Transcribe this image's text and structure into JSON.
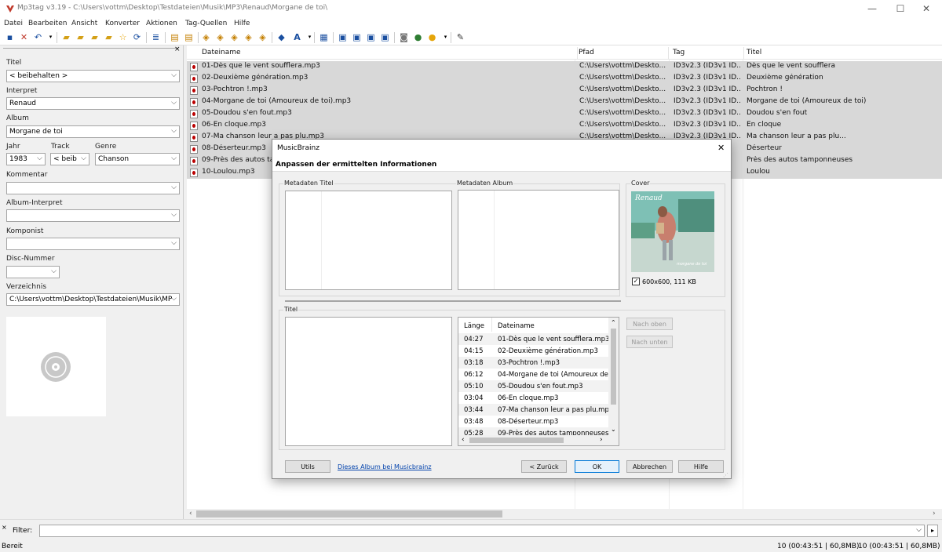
{
  "window": {
    "title": "Mp3tag v3.19  -  C:\\Users\\vottm\\Desktop\\Testdateien\\Musik\\MP3\\Renaud\\Morgane de toi\\",
    "minimize": "—",
    "maximize": "☐",
    "close": "✕"
  },
  "menu": [
    "Datei",
    "Bearbeiten",
    "Ansicht",
    "Konverter",
    "Aktionen",
    "Tag-Quellen",
    "Hilfe"
  ],
  "toolbar_icons": [
    "save-icon",
    "delete-icon",
    "undo-icon",
    "open-folder-icon",
    "add-folder-icon",
    "folder-icon",
    "folder-star-icon",
    "favorite-icon",
    "refresh-icon",
    "playlist-icon",
    "tag-filename-icon",
    "filename-tag-icon",
    "tag-tag-icon",
    "text-filename-icon",
    "export-icon",
    "actions-icon",
    "case-icon",
    "autonumber-icon",
    "tag-edit-icon",
    "freedb-icon",
    "musicbrainz-icon",
    "discogs-icon",
    "amazon-icon",
    "cd-icon",
    "web-icon",
    "settings-icon"
  ],
  "panel": {
    "close": "×",
    "title_label": "Titel",
    "title_value": "< beibehalten >",
    "artist_label": "Interpret",
    "artist_value": "Renaud",
    "album_label": "Album",
    "album_value": "Morgane de toi",
    "year_label": "Jahr",
    "year_value": "1983",
    "track_label": "Track",
    "track_value": "< beib",
    "genre_label": "Genre",
    "genre_value": "Chanson",
    "comment_label": "Kommentar",
    "comment_value": "",
    "albumartist_label": "Album-Interpret",
    "albumartist_value": "",
    "composer_label": "Komponist",
    "composer_value": "",
    "disc_label": "Disc-Nummer",
    "disc_value": "",
    "dir_label": "Verzeichnis",
    "dir_value": "C:\\Users\\vottm\\Desktop\\Testdateien\\Musik\\MP"
  },
  "columns": [
    "Dateiname",
    "Pfad",
    "Tag",
    "Titel"
  ],
  "files": [
    {
      "name": "01-Dès que le vent soufflera.mp3",
      "path": "C:\\Users\\vottm\\Deskto...",
      "tag": "ID3v2.3 (ID3v1 ID...",
      "title": "Dès que le vent soufflera"
    },
    {
      "name": "02-Deuxième génération.mp3",
      "path": "C:\\Users\\vottm\\Deskto...",
      "tag": "ID3v2.3 (ID3v1 ID...",
      "title": "Deuxième génération"
    },
    {
      "name": "03-Pochtron !.mp3",
      "path": "C:\\Users\\vottm\\Deskto...",
      "tag": "ID3v2.3 (ID3v1 ID...",
      "title": "Pochtron !"
    },
    {
      "name": "04-Morgane de toi (Amoureux de toi).mp3",
      "path": "C:\\Users\\vottm\\Deskto...",
      "tag": "ID3v2.3 (ID3v1 ID...",
      "title": "Morgane de toi (Amoureux de toi)"
    },
    {
      "name": "05-Doudou s'en fout.mp3",
      "path": "C:\\Users\\vottm\\Deskto...",
      "tag": "ID3v2.3 (ID3v1 ID...",
      "title": "Doudou s'en fout"
    },
    {
      "name": "06-En cloque.mp3",
      "path": "C:\\Users\\vottm\\Deskto...",
      "tag": "ID3v2.3 (ID3v1 ID...",
      "title": "En cloque"
    },
    {
      "name": "07-Ma chanson leur a pas plu.mp3",
      "path": "C:\\Users\\vottm\\Deskto...",
      "tag": "ID3v2.3 (ID3v1 ID...",
      "title": "Ma chanson leur a pas plu..."
    },
    {
      "name": "08-Déserteur.mp3",
      "path": "",
      "tag": "",
      "title": "Déserteur"
    },
    {
      "name": "09-Près des autos tamponneuses.mp3",
      "path": "",
      "tag": "",
      "title": "Près des autos tamponneuses"
    },
    {
      "name": "10-Loulou.mp3",
      "path": "",
      "tag": "",
      "title": "Loulou"
    }
  ],
  "filter": {
    "label": "Filter:",
    "value": ""
  },
  "status": {
    "left": "Bereit",
    "right1": "10 (00:43:51 | 60,8MB)",
    "right2": "10 (00:43:51 | 60,8MB)"
  },
  "dialog": {
    "title": "MusicBrainz",
    "close": "✕",
    "heading": "Anpassen der ermittelten Informationen",
    "meta_title": "Metadaten Titel",
    "meta_album": "Metadaten Album",
    "cover_label": "Cover",
    "cover_checked": true,
    "cover_info": "600x600, 111 KB",
    "cover_text_top": "Renaud",
    "cover_text_bottom": "morgane de toi",
    "titel_label": "Titel",
    "col_length": "Länge",
    "col_file": "Dateiname",
    "tracks": [
      {
        "len": "04:27",
        "file": "01-Dès que le vent soufflera.mp3"
      },
      {
        "len": "04:15",
        "file": "02-Deuxième génération.mp3"
      },
      {
        "len": "03:18",
        "file": "03-Pochtron !.mp3"
      },
      {
        "len": "06:12",
        "file": "04-Morgane de toi (Amoureux de"
      },
      {
        "len": "05:10",
        "file": "05-Doudou s'en fout.mp3"
      },
      {
        "len": "03:04",
        "file": "06-En cloque.mp3"
      },
      {
        "len": "03:44",
        "file": "07-Ma chanson leur a pas plu.mp"
      },
      {
        "len": "03:48",
        "file": "08-Déserteur.mp3"
      },
      {
        "len": "05:28",
        "file": "09-Près des autos tamponneuses"
      }
    ],
    "btn_up": "Nach oben",
    "btn_down": "Nach unten",
    "btn_utils": "Utils",
    "link_album": "Dieses Album bei Musicbrainz",
    "btn_back": "< Zurück",
    "btn_ok": "OK",
    "btn_cancel": "Abbrechen",
    "btn_help": "Hilfe"
  }
}
